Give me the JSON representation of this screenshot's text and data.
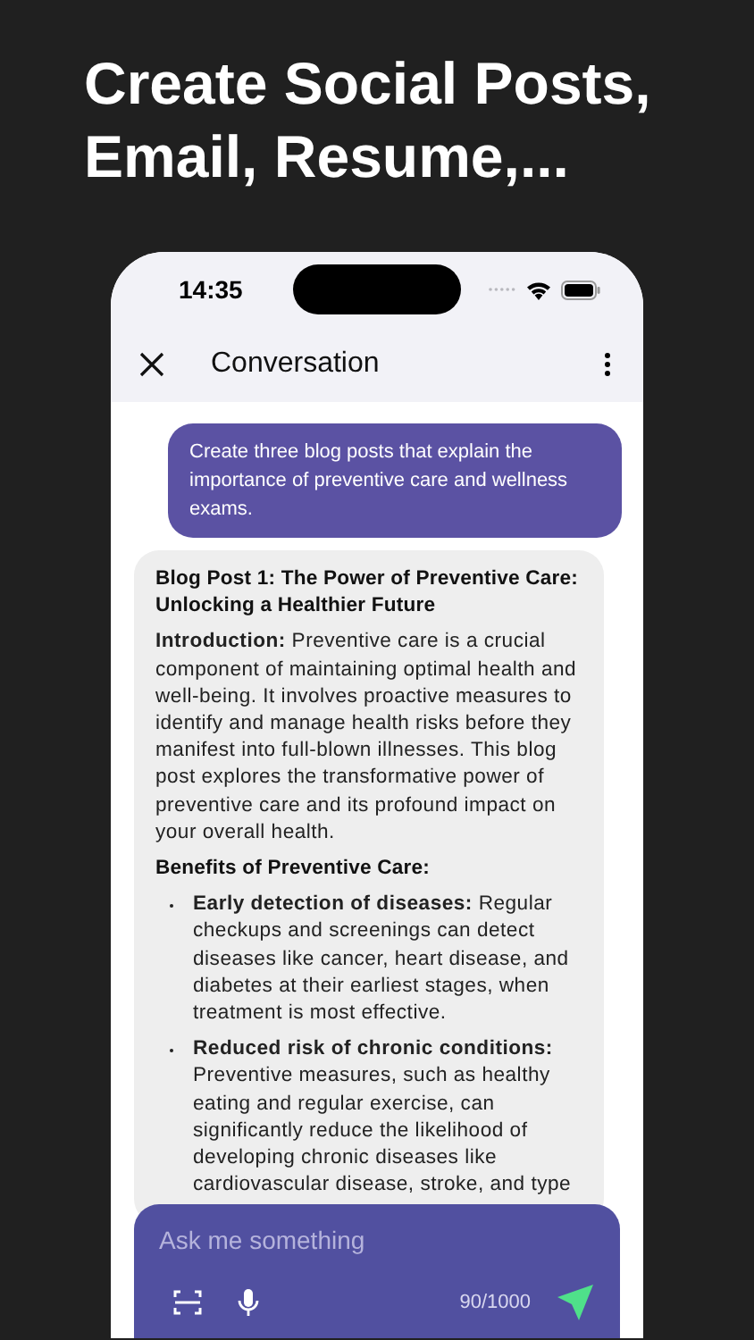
{
  "headline": "Create Social Posts, Email, Resume,...",
  "status_bar": {
    "time": "14:35"
  },
  "nav": {
    "title": "Conversation"
  },
  "messages": [
    {
      "kind": "user",
      "text": "Create three blog posts that explain the importance of preventive care and wellness exams."
    },
    {
      "kind": "assistant",
      "blocks": [
        {
          "kind": "heading",
          "text": "Blog Post 1: The Power of Preventive Care: Unlocking a Healthier Future"
        },
        {
          "kind": "paragraph",
          "text": "**Introduction:** Preventive care is a crucial component of maintaining optimal health and well-being. It involves proactive measures to identify and manage health risks before they manifest into full-blown illnesses. This blog post explores the transformative power of preventive care and its profound impact on your overall health."
        },
        {
          "kind": "heading",
          "text": "Benefits of Preventive Care:"
        },
        {
          "kind": "bullet",
          "text": "**Early detection of diseases:** Regular checkups and screenings can detect diseases like cancer, heart disease, and diabetes at their earliest stages, when treatment is most effective."
        },
        {
          "kind": "bullet",
          "text": "**Reduced risk of chronic conditions:** Preventive measures, such as healthy eating and regular exercise, can significantly reduce the likelihood of developing chronic diseases like cardiovascular disease, stroke, and type"
        }
      ]
    }
  ],
  "composer": {
    "placeholder": "Ask me something",
    "counter": "90/1000"
  }
}
